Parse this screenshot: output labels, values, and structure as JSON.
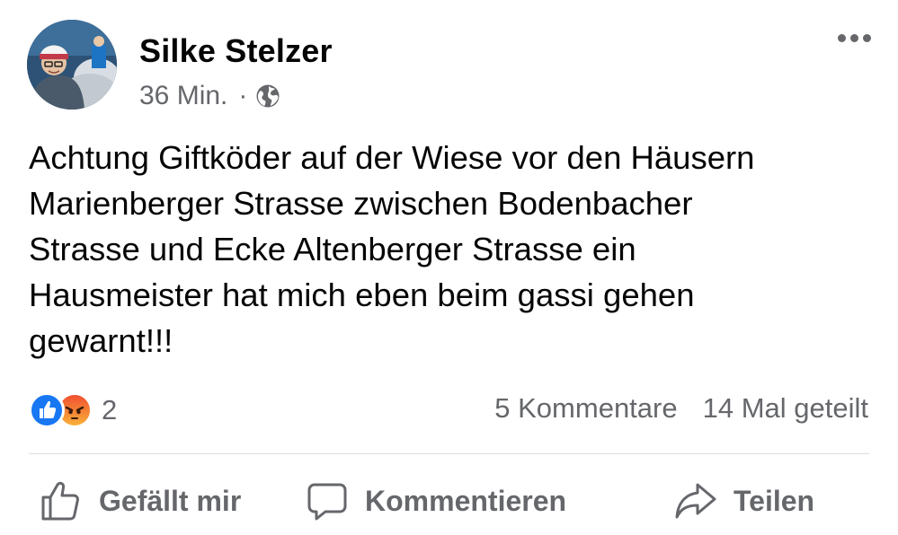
{
  "post": {
    "author": "Silke Stelzer",
    "time": "36 Min.",
    "separator": "·",
    "audience_icon": "globe-icon",
    "text": "Achtung Giftköder auf der Wiese vor den Häusern\nMarienberger Strasse zwischen Bodenbacher\nStrasse und Ecke Altenberger Strasse ein\nHausmeister hat mich eben beim gassi gehen\ngewarnt!!!"
  },
  "reactions": {
    "icons": [
      "like-icon",
      "angry-icon"
    ],
    "count": "2"
  },
  "stats": {
    "comments": "5 Kommentare",
    "shares": "14 Mal geteilt"
  },
  "actions": {
    "like": "Gefällt mir",
    "comment": "Kommentieren",
    "share": "Teilen"
  },
  "colors": {
    "like_blue": "#1877f2",
    "secondary_text": "#65676b",
    "divider": "#dadde1"
  }
}
